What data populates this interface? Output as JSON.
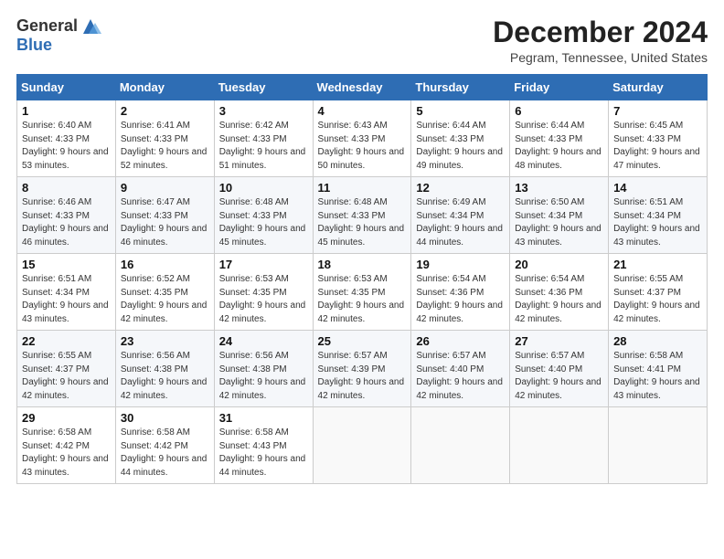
{
  "logo": {
    "general": "General",
    "blue": "Blue"
  },
  "title": "December 2024",
  "location": "Pegram, Tennessee, United States",
  "days_of_week": [
    "Sunday",
    "Monday",
    "Tuesday",
    "Wednesday",
    "Thursday",
    "Friday",
    "Saturday"
  ],
  "weeks": [
    [
      {
        "day": "1",
        "sunrise": "6:40 AM",
        "sunset": "4:33 PM",
        "daylight": "9 hours and 53 minutes."
      },
      {
        "day": "2",
        "sunrise": "6:41 AM",
        "sunset": "4:33 PM",
        "daylight": "9 hours and 52 minutes."
      },
      {
        "day": "3",
        "sunrise": "6:42 AM",
        "sunset": "4:33 PM",
        "daylight": "9 hours and 51 minutes."
      },
      {
        "day": "4",
        "sunrise": "6:43 AM",
        "sunset": "4:33 PM",
        "daylight": "9 hours and 50 minutes."
      },
      {
        "day": "5",
        "sunrise": "6:44 AM",
        "sunset": "4:33 PM",
        "daylight": "9 hours and 49 minutes."
      },
      {
        "day": "6",
        "sunrise": "6:44 AM",
        "sunset": "4:33 PM",
        "daylight": "9 hours and 48 minutes."
      },
      {
        "day": "7",
        "sunrise": "6:45 AM",
        "sunset": "4:33 PM",
        "daylight": "9 hours and 47 minutes."
      }
    ],
    [
      {
        "day": "8",
        "sunrise": "6:46 AM",
        "sunset": "4:33 PM",
        "daylight": "9 hours and 46 minutes."
      },
      {
        "day": "9",
        "sunrise": "6:47 AM",
        "sunset": "4:33 PM",
        "daylight": "9 hours and 46 minutes."
      },
      {
        "day": "10",
        "sunrise": "6:48 AM",
        "sunset": "4:33 PM",
        "daylight": "9 hours and 45 minutes."
      },
      {
        "day": "11",
        "sunrise": "6:48 AM",
        "sunset": "4:33 PM",
        "daylight": "9 hours and 45 minutes."
      },
      {
        "day": "12",
        "sunrise": "6:49 AM",
        "sunset": "4:34 PM",
        "daylight": "9 hours and 44 minutes."
      },
      {
        "day": "13",
        "sunrise": "6:50 AM",
        "sunset": "4:34 PM",
        "daylight": "9 hours and 43 minutes."
      },
      {
        "day": "14",
        "sunrise": "6:51 AM",
        "sunset": "4:34 PM",
        "daylight": "9 hours and 43 minutes."
      }
    ],
    [
      {
        "day": "15",
        "sunrise": "6:51 AM",
        "sunset": "4:34 PM",
        "daylight": "9 hours and 43 minutes."
      },
      {
        "day": "16",
        "sunrise": "6:52 AM",
        "sunset": "4:35 PM",
        "daylight": "9 hours and 42 minutes."
      },
      {
        "day": "17",
        "sunrise": "6:53 AM",
        "sunset": "4:35 PM",
        "daylight": "9 hours and 42 minutes."
      },
      {
        "day": "18",
        "sunrise": "6:53 AM",
        "sunset": "4:35 PM",
        "daylight": "9 hours and 42 minutes."
      },
      {
        "day": "19",
        "sunrise": "6:54 AM",
        "sunset": "4:36 PM",
        "daylight": "9 hours and 42 minutes."
      },
      {
        "day": "20",
        "sunrise": "6:54 AM",
        "sunset": "4:36 PM",
        "daylight": "9 hours and 42 minutes."
      },
      {
        "day": "21",
        "sunrise": "6:55 AM",
        "sunset": "4:37 PM",
        "daylight": "9 hours and 42 minutes."
      }
    ],
    [
      {
        "day": "22",
        "sunrise": "6:55 AM",
        "sunset": "4:37 PM",
        "daylight": "9 hours and 42 minutes."
      },
      {
        "day": "23",
        "sunrise": "6:56 AM",
        "sunset": "4:38 PM",
        "daylight": "9 hours and 42 minutes."
      },
      {
        "day": "24",
        "sunrise": "6:56 AM",
        "sunset": "4:38 PM",
        "daylight": "9 hours and 42 minutes."
      },
      {
        "day": "25",
        "sunrise": "6:57 AM",
        "sunset": "4:39 PM",
        "daylight": "9 hours and 42 minutes."
      },
      {
        "day": "26",
        "sunrise": "6:57 AM",
        "sunset": "4:40 PM",
        "daylight": "9 hours and 42 minutes."
      },
      {
        "day": "27",
        "sunrise": "6:57 AM",
        "sunset": "4:40 PM",
        "daylight": "9 hours and 42 minutes."
      },
      {
        "day": "28",
        "sunrise": "6:58 AM",
        "sunset": "4:41 PM",
        "daylight": "9 hours and 43 minutes."
      }
    ],
    [
      {
        "day": "29",
        "sunrise": "6:58 AM",
        "sunset": "4:42 PM",
        "daylight": "9 hours and 43 minutes."
      },
      {
        "day": "30",
        "sunrise": "6:58 AM",
        "sunset": "4:42 PM",
        "daylight": "9 hours and 44 minutes."
      },
      {
        "day": "31",
        "sunrise": "6:58 AM",
        "sunset": "4:43 PM",
        "daylight": "9 hours and 44 minutes."
      },
      null,
      null,
      null,
      null
    ]
  ],
  "labels": {
    "sunrise": "Sunrise:",
    "sunset": "Sunset:",
    "daylight": "Daylight:"
  }
}
